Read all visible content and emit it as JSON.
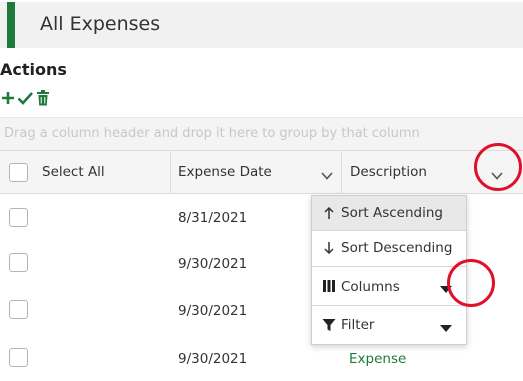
{
  "page": {
    "title": "All Expenses",
    "accent_color": "#1e7a3c"
  },
  "actions": {
    "label": "Actions",
    "icons": [
      "plus-icon",
      "check-icon",
      "trash-icon"
    ]
  },
  "grid": {
    "group_panel_text": "Drag a column header and drop it here to group by that column",
    "columns": {
      "select_all": "Select All",
      "expense_date": "Expense Date",
      "description": "Description"
    },
    "rows": [
      {
        "date": "8/31/2021",
        "description": ""
      },
      {
        "date": "9/30/2021",
        "description": ""
      },
      {
        "date": "9/30/2021",
        "description": ""
      },
      {
        "date": "9/30/2021",
        "description": "Expense"
      }
    ]
  },
  "column_menu": {
    "sort_ascending": "Sort Ascending",
    "sort_descending": "Sort Descending",
    "columns": "Columns",
    "filter": "Filter"
  },
  "annotation_color": "#e0102b"
}
